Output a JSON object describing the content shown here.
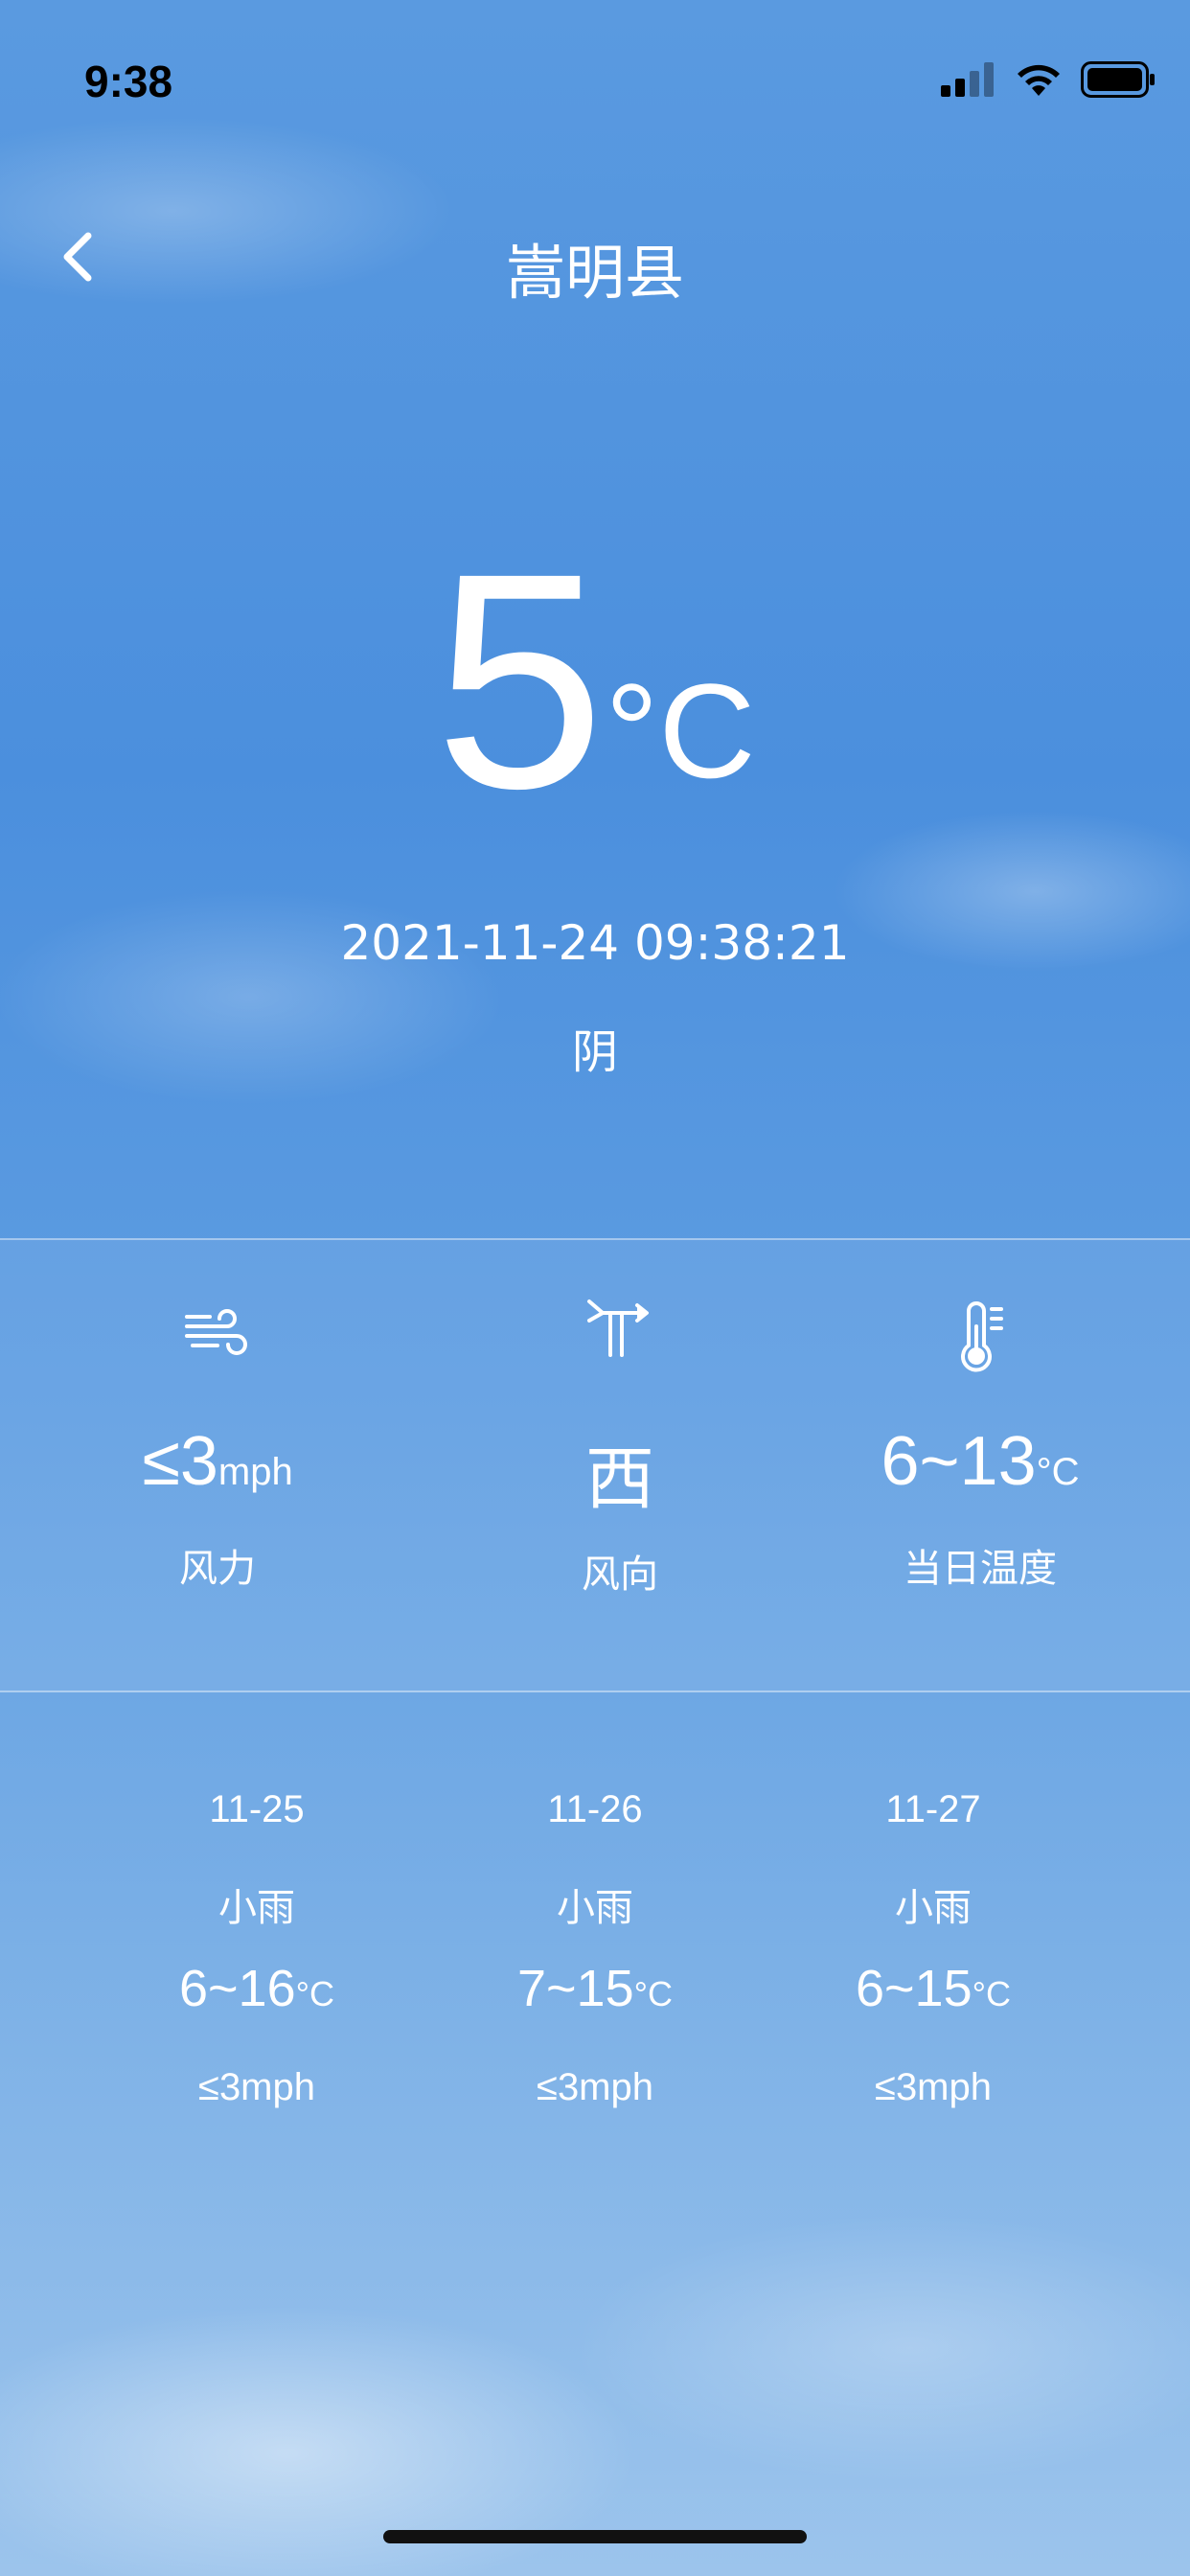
{
  "status_bar": {
    "time": "9:38"
  },
  "header": {
    "city": "嵩明县"
  },
  "current": {
    "temperature": "5",
    "unit": "°C",
    "datetime": "2021-11-24 09:38:21",
    "condition": "阴"
  },
  "details": [
    {
      "icon": "wind-icon",
      "value": "≤3",
      "unit": "mph",
      "label": "风力"
    },
    {
      "icon": "wind-vane-icon",
      "value": "西",
      "unit": "",
      "label": "风向"
    },
    {
      "icon": "thermometer-icon",
      "value": "6~13",
      "unit": "°C",
      "label": "当日温度"
    }
  ],
  "forecast": [
    {
      "date": "11-25",
      "condition": "小雨",
      "temp": "6~16",
      "unit": "°C",
      "wind": "≤3mph"
    },
    {
      "date": "11-26",
      "condition": "小雨",
      "temp": "7~15",
      "unit": "°C",
      "wind": "≤3mph"
    },
    {
      "date": "11-27",
      "condition": "小雨",
      "temp": "6~15",
      "unit": "°C",
      "wind": "≤3mph"
    }
  ],
  "colors": {
    "sky_top": "#4b8fdd",
    "sky_bottom": "#9cc4ec",
    "text": "#ffffff"
  }
}
